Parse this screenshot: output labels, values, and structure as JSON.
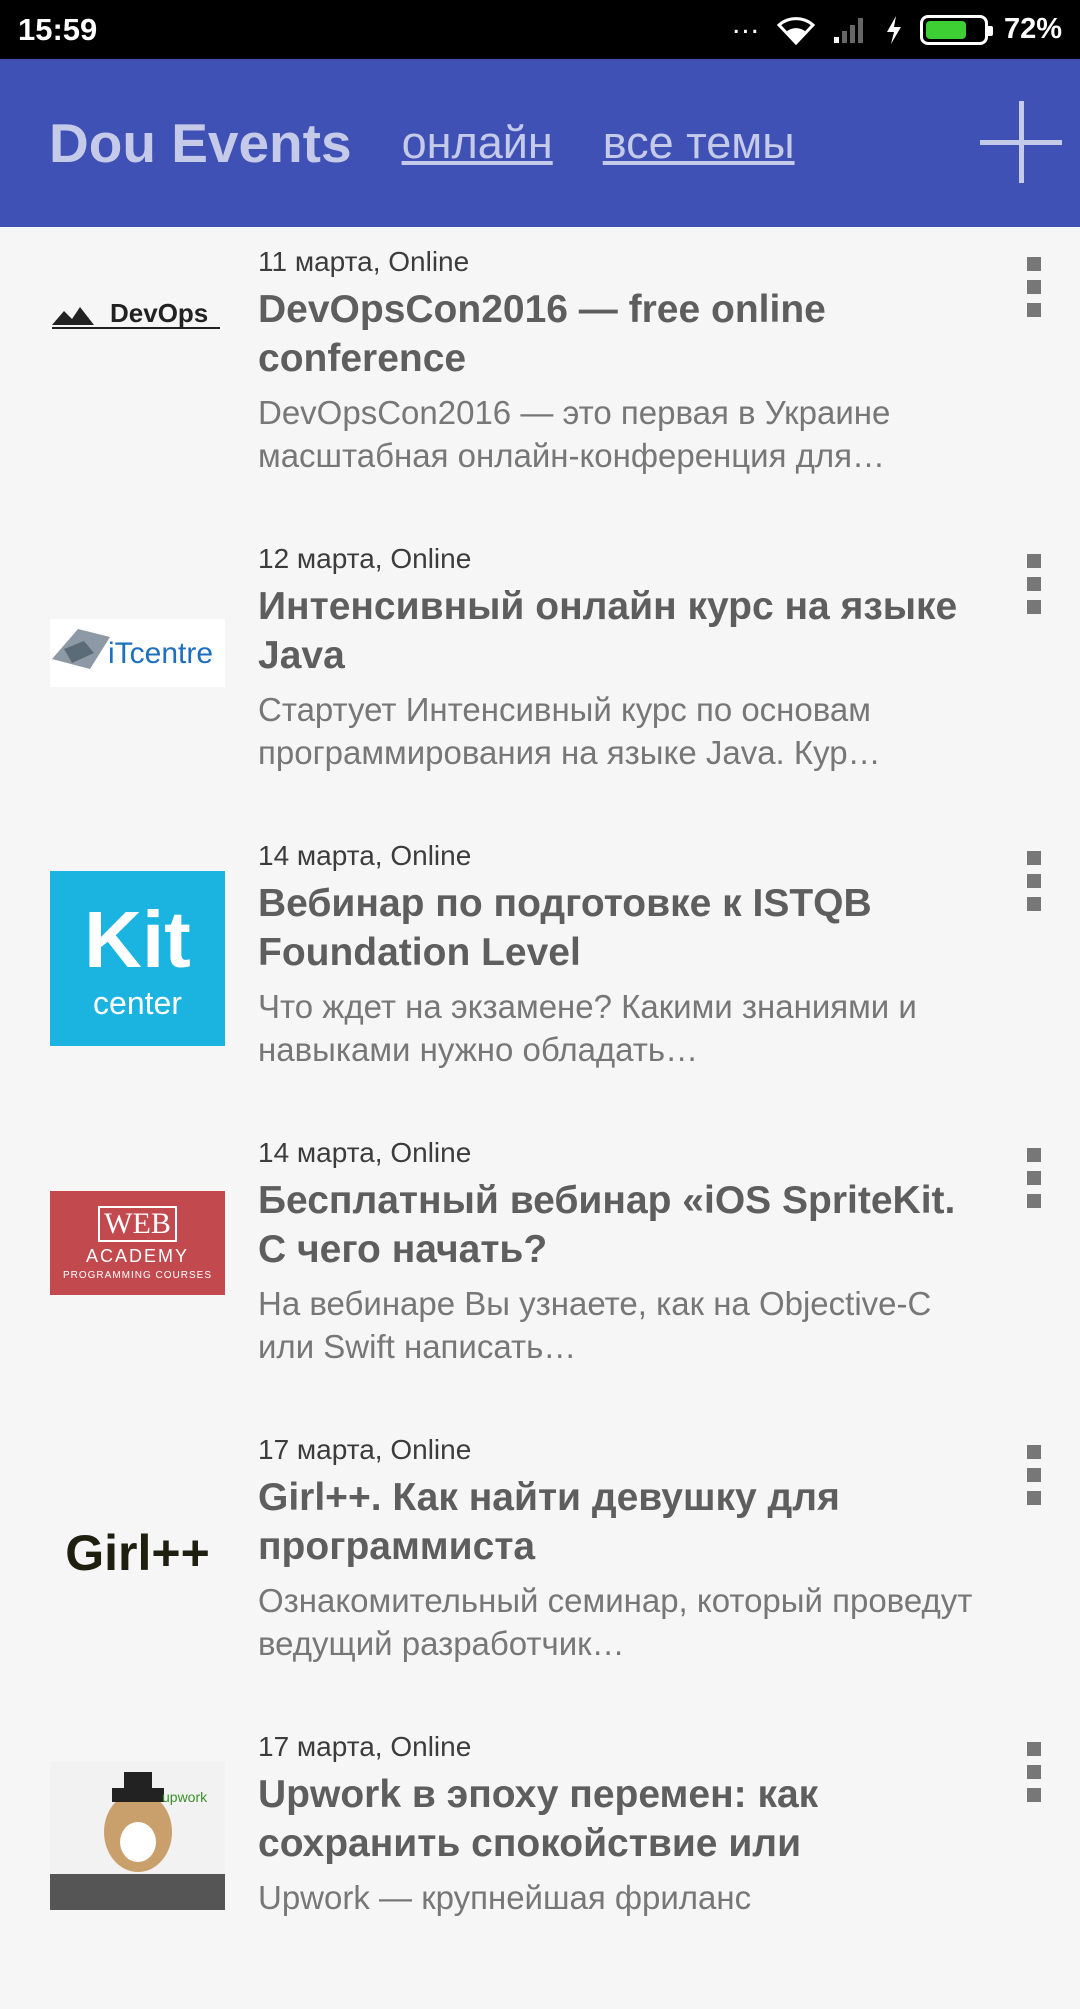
{
  "status_bar": {
    "time": "15:59",
    "dots": "...",
    "battery_percent": "72%",
    "battery_level": 0.72,
    "battery_color": "#3ecf35"
  },
  "toolbar": {
    "title": "Dou Events",
    "filter_online": "онлайн",
    "filter_topics": "все темы",
    "add_icon": "plus-icon",
    "color": "#3f51b5"
  },
  "events": [
    {
      "date": "11 марта, Online",
      "title": "DevOpsCon2016 — free online conference",
      "description": "DevOpsCon2016 — это первая в Украине масштабная онлайн-конференция для…",
      "logo_text": "DevOps"
    },
    {
      "date": "12 марта, Online",
      "title": "Интенсивный онлайн курс на языке Java",
      "description": "Стартует Интенсивный курс по основам программирования на языке Java. Кур…",
      "logo_text": "iTcentre"
    },
    {
      "date": "14 марта, Online",
      "title": "Вебинар по подготовке к ISTQB Foundation Level",
      "description": "Что ждет на экзамене? Какими знаниями и навыками нужно обладать…",
      "logo_text": "Kit",
      "logo_subtext": "center"
    },
    {
      "date": "14 марта, Online",
      "title": "Бесплатный вебинар «iOS SpriteKit. С чего начать?",
      "description": "На вебинаре Вы узнаете, как на Objective-C или Swift написать…",
      "logo_text": "WEB",
      "logo_subtext": "ACADEMY",
      "logo_subtext2": "PROGRAMMING COURSES"
    },
    {
      "date": "17 марта, Online",
      "title": "Girl++. Как найти девушку для программиста",
      "description": "Ознакомительный семинар, который проведут ведущий разработчик…",
      "logo_text": "Girl++"
    },
    {
      "date": "17 марта, Online",
      "title": "Upwork в эпоху перемен: как сохранить спокойствие или",
      "description": "Upwork — крупнейшая фриланс",
      "logo_text": "upwork"
    }
  ]
}
